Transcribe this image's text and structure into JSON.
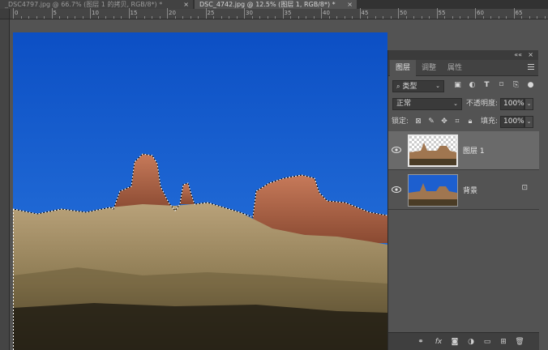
{
  "tabs": [
    {
      "label": "_DSC4797.jpg @ 66.7% (图层 1 的拷贝, RGB/8*) *",
      "close": "×"
    },
    {
      "label": "DSC_4742.jpg @ 12.5% (图层 1, RGB/8*) *",
      "close": "×"
    }
  ],
  "ruler": {
    "top_numbers": [
      "0",
      "5",
      "10",
      "15",
      "20",
      "25",
      "30",
      "35",
      "40",
      "45",
      "50",
      "55",
      "60",
      "65"
    ]
  },
  "panel": {
    "collapse": "««",
    "close": "×",
    "tabs": [
      "图层",
      "调整",
      "属性"
    ],
    "filter": {
      "label": "类型",
      "chev": "⌄"
    },
    "filter_icons": [
      "image-filter-icon",
      "adjustment-filter-icon",
      "type-filter-icon",
      "shape-filter-icon",
      "smart-object-filter-icon"
    ],
    "blend": {
      "value": "正常",
      "chev": "⌄"
    },
    "opacity": {
      "label": "不透明度:",
      "value": "100%",
      "chev": "⌄"
    },
    "lock": {
      "label": "锁定:"
    },
    "fill": {
      "label": "填充:",
      "value": "100%",
      "chev": "⌄"
    },
    "layers": [
      {
        "name": "图层 1",
        "selected": true
      },
      {
        "name": "背景",
        "selected": false,
        "locked": true
      }
    ],
    "bottom_icons": [
      "link-icon",
      "fx",
      "mask-icon",
      "adjustment-icon",
      "folder-icon",
      "new-layer-icon",
      "trash-icon"
    ],
    "fx_label": "fx"
  },
  "colors": {
    "sky": "#1a5fd1",
    "panel_bg": "#535353",
    "selected_layer": "#6a6a6a"
  }
}
